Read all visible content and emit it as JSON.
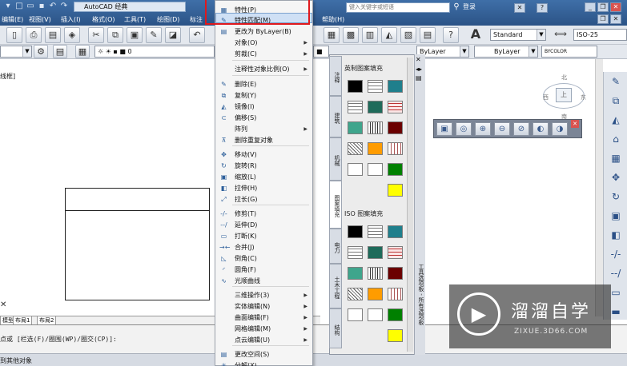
{
  "titlebar": {
    "workspace": "AutoCAD 经典",
    "search_placeholder": "键入关键字或短语",
    "sign_in": "登录",
    "menus": [
      "编辑(E)",
      "视图(V)",
      "插入(I)",
      "格式(O)",
      "工具(T)",
      "绘图(D)",
      "标注"
    ],
    "help_menu": "帮助(H)"
  },
  "toolbar": {
    "text_style": "Standard",
    "dim_style": "ISO-25",
    "layer_value": "0",
    "bylayer_1": "ByLayer",
    "bylayer_2": "ByLayer",
    "bylayer_3": "ByLayer",
    "bycolor": "BYCOLOR"
  },
  "context_menu": {
    "items": [
      {
        "label": "特性(P)",
        "icon": "properties-icon",
        "submenu": false
      },
      {
        "label": "特性匹配(M)",
        "icon": "match-properties-icon",
        "submenu": false,
        "highlighted": true
      },
      {
        "label": "更改为 ByLayer(B)",
        "icon": "bylayer-icon",
        "submenu": false
      },
      {
        "label": "对象(O)",
        "icon": "",
        "submenu": true
      },
      {
        "label": "剪裁(C)",
        "icon": "",
        "submenu": true
      },
      {
        "label": "注释性对象比例(O)",
        "icon": "",
        "submenu": true
      },
      {
        "label": "删除(E)",
        "icon": "erase-icon",
        "submenu": false
      },
      {
        "label": "复制(Y)",
        "icon": "copy-icon",
        "submenu": false
      },
      {
        "label": "镜像(I)",
        "icon": "mirror-icon",
        "submenu": false
      },
      {
        "label": "偏移(S)",
        "icon": "offset-icon",
        "submenu": false
      },
      {
        "label": "阵列",
        "icon": "",
        "submenu": true
      },
      {
        "label": "删除重复对象",
        "icon": "overkill-icon",
        "submenu": false
      },
      {
        "label": "移动(V)",
        "icon": "move-icon",
        "submenu": false
      },
      {
        "label": "旋转(R)",
        "icon": "rotate-icon",
        "submenu": false
      },
      {
        "label": "缩放(L)",
        "icon": "scale-icon",
        "submenu": false
      },
      {
        "label": "拉伸(H)",
        "icon": "stretch-icon",
        "submenu": false
      },
      {
        "label": "拉长(G)",
        "icon": "lengthen-icon",
        "submenu": false
      },
      {
        "label": "修剪(T)",
        "icon": "trim-icon",
        "submenu": false
      },
      {
        "label": "延伸(D)",
        "icon": "extend-icon",
        "submenu": false
      },
      {
        "label": "打断(K)",
        "icon": "break-icon",
        "submenu": false
      },
      {
        "label": "合并(J)",
        "icon": "join-icon",
        "submenu": false
      },
      {
        "label": "倒角(C)",
        "icon": "chamfer-icon",
        "submenu": false
      },
      {
        "label": "圆角(F)",
        "icon": "fillet-icon",
        "submenu": false
      },
      {
        "label": "光顺曲线",
        "icon": "blend-curves-icon",
        "submenu": false
      },
      {
        "label": "三维操作(3)",
        "icon": "",
        "submenu": true
      },
      {
        "label": "实体编辑(N)",
        "icon": "",
        "submenu": true
      },
      {
        "label": "曲面编辑(F)",
        "icon": "",
        "submenu": true
      },
      {
        "label": "网格编辑(M)",
        "icon": "",
        "submenu": true
      },
      {
        "label": "点云编辑(U)",
        "icon": "",
        "submenu": true
      },
      {
        "label": "更改空间(S)",
        "icon": "change-space-icon",
        "submenu": false
      },
      {
        "label": "分解(X)",
        "icon": "explode-icon",
        "submenu": false
      }
    ]
  },
  "palette": {
    "title": "工具选项板 - 所有选项板",
    "tabs": [
      "注释",
      "建筑",
      "机械",
      "图案填充",
      "电力",
      "土木工程",
      "结构"
    ],
    "active_tab": "图案填充",
    "section1": "英制图案填充",
    "section2": "ISO 图案填充",
    "colors": {
      "black": "#000000",
      "teal": "#1f7f8c",
      "dark_green": "#1e6b5a",
      "green_gray": "#3fa58c",
      "dark_red": "#6b0000",
      "orange": "#ff9c00",
      "green": "#008000",
      "yellow": "#ffff00"
    }
  },
  "viewcube": {
    "north": "北",
    "west": "西",
    "east": "东",
    "top": "上",
    "south": "南"
  },
  "drawing": {
    "view_label": "线框]"
  },
  "layout_tabs": [
    "模型",
    "布局1",
    "布局2"
  ],
  "command_line": {
    "line1": "点或 [栏选(F)/圈围(WP)/圈交(CP)]:",
    "line2": "到其他对象"
  },
  "watermark": {
    "title": "溜溜自学",
    "url": "ZIXUE.3D66.COM",
    "logo": "▶"
  }
}
